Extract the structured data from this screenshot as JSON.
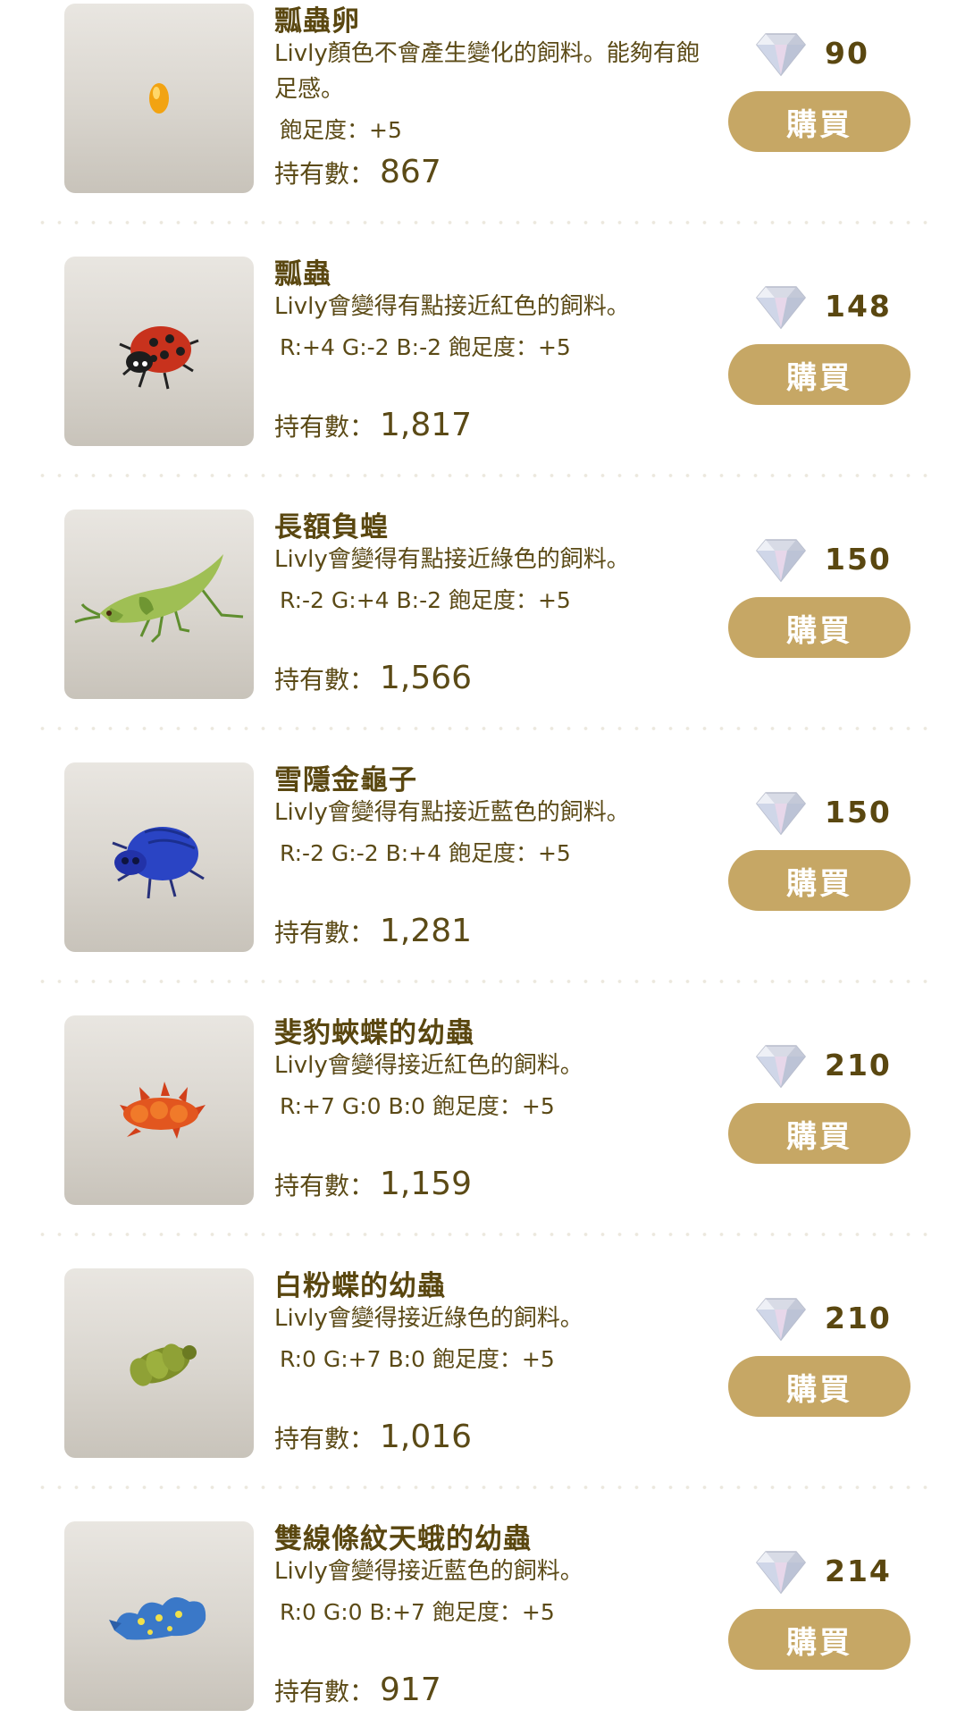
{
  "labels": {
    "owned_prefix": "持有數：",
    "buy": "購買"
  },
  "colors": {
    "accent_gold": "#c6a765",
    "text_brown": "#5b4a16"
  },
  "currency_icon": "diamond-icon",
  "items": [
    {
      "name": "瓢蟲卵",
      "description": "Livly顏色不會產生變化的飼料。能夠有飽足感。",
      "stats": "飽足度：+5",
      "owned": "867",
      "price": "90",
      "image": "ladybug-egg-icon"
    },
    {
      "name": "瓢蟲",
      "description": "Livly會變得有點接近紅色的飼料。",
      "stats": "R:+4 G:-2 B:-2 飽足度：+5",
      "owned": "1,817",
      "price": "148",
      "image": "ladybug-icon"
    },
    {
      "name": "長額負蝗",
      "description": "Livly會變得有點接近綠色的飼料。",
      "stats": "R:-2 G:+4 B:-2 飽足度：+5",
      "owned": "1,566",
      "price": "150",
      "image": "grasshopper-icon"
    },
    {
      "name": "雪隱金龜子",
      "description": "Livly會變得有點接近藍色的飼料。",
      "stats": "R:-2 G:-2 B:+4 飽足度：+5",
      "owned": "1,281",
      "price": "150",
      "image": "blue-beetle-icon"
    },
    {
      "name": "斐豹蛺蝶的幼蟲",
      "description": "Livly會變得接近紅色的飼料。",
      "stats": "R:+7 G:0 B:0 飽足度：+5",
      "owned": "1,159",
      "price": "210",
      "image": "red-caterpillar-icon"
    },
    {
      "name": "白粉蝶的幼蟲",
      "description": "Livly會變得接近綠色的飼料。",
      "stats": "R:0 G:+7 B:0 飽足度：+5",
      "owned": "1,016",
      "price": "210",
      "image": "green-caterpillar-icon"
    },
    {
      "name": "雙線條紋天蛾的幼蟲",
      "description": "Livly會變得接近藍色的飼料。",
      "stats": "R:0 G:0 B:+7 飽足度：+5",
      "owned": "917",
      "price": "214",
      "image": "blue-caterpillar-icon"
    }
  ]
}
